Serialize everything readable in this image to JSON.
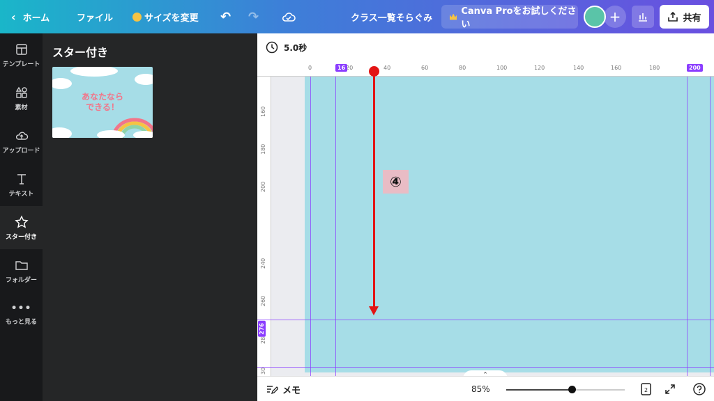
{
  "topbar": {
    "home_label": "ホーム",
    "file_label": "ファイル",
    "resize_label": "サイズを変更",
    "design_title": "クラス一覧そらぐみ",
    "pro_label": "Canva Proをお試しください",
    "share_label": "共有"
  },
  "rail": [
    {
      "label": "テンプレート",
      "icon": "template-icon"
    },
    {
      "label": "素材",
      "icon": "elements-icon"
    },
    {
      "label": "アップロード",
      "icon": "upload-icon"
    },
    {
      "label": "テキスト",
      "icon": "text-icon"
    },
    {
      "label": "スター付き",
      "icon": "star-icon"
    },
    {
      "label": "フォルダー",
      "icon": "folder-icon"
    },
    {
      "label": "もっと見る",
      "icon": "more-icon"
    }
  ],
  "panel": {
    "title": "スター付き",
    "thumb_text_line1": "あなたなら",
    "thumb_text_line2": "できる！"
  },
  "canvas": {
    "duration": "5.0秒",
    "ruler_top_ticks": [
      "0",
      "20",
      "40",
      "60",
      "80",
      "100",
      "120",
      "140",
      "160",
      "180"
    ],
    "ruler_left_ticks": [
      "160",
      "180",
      "200",
      "240",
      "260",
      "28",
      "30"
    ],
    "guide_v1": "16",
    "guide_v2": "200",
    "guide_h1": "276",
    "step_label": "④"
  },
  "bottombar": {
    "memo_label": "メモ",
    "zoom": "85%",
    "zoom_fraction": 0.55,
    "page_count": "2"
  },
  "colors": {
    "accent": "#8b3dff",
    "canvas_bg": "#a6dde7",
    "arrow": "#e31414"
  }
}
